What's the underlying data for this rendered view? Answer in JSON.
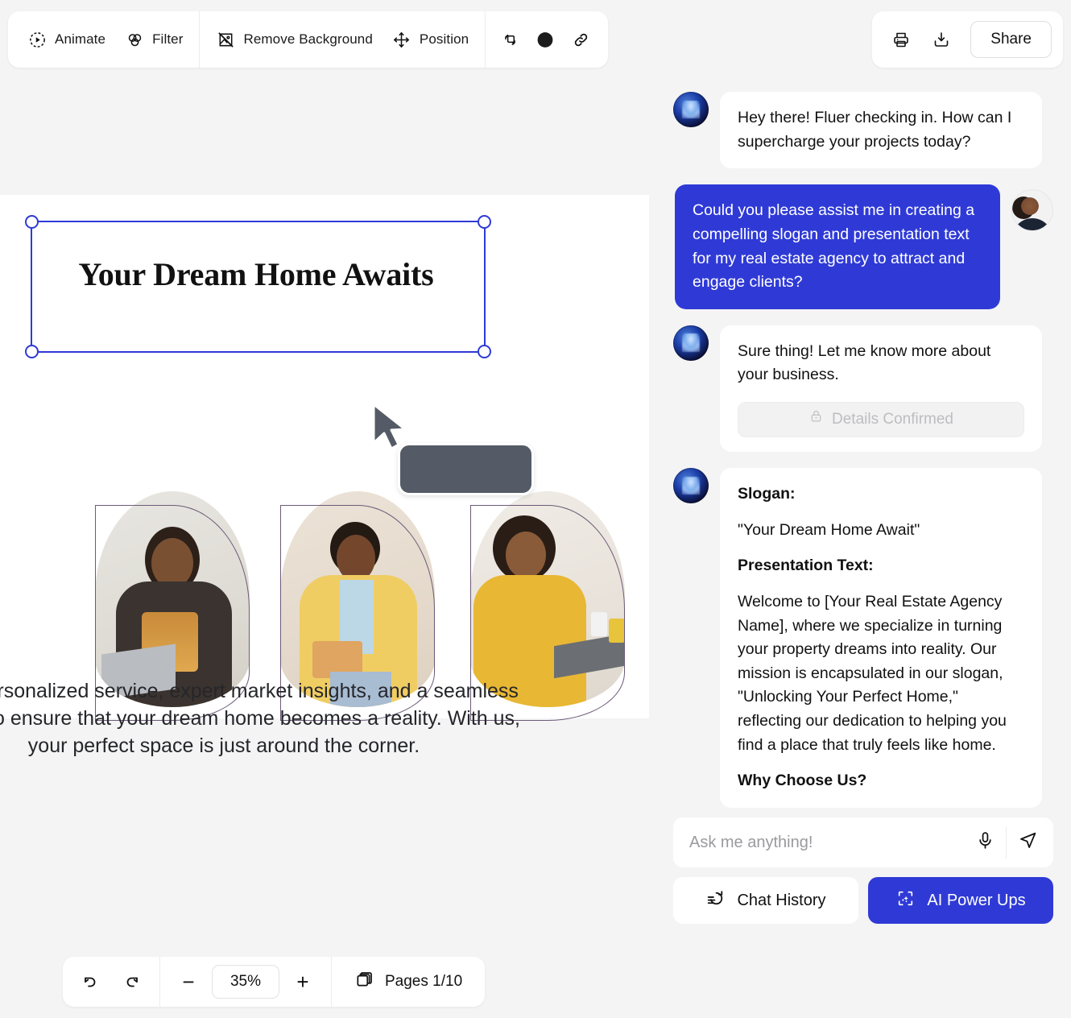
{
  "toolbar": {
    "items": [
      {
        "label": "Animate",
        "icon": "animate-icon"
      },
      {
        "label": "Filter",
        "icon": "filter-icon"
      },
      {
        "label": "Remove Background",
        "icon": "remove-background-icon"
      },
      {
        "label": "Position",
        "icon": "position-icon"
      }
    ],
    "icon_buttons": [
      {
        "name": "duplicate-icon"
      },
      {
        "name": "color-swatch-icon",
        "color": "#1c1c1c"
      },
      {
        "name": "link-icon"
      }
    ],
    "right": {
      "print_icon": "print-icon",
      "download_icon": "download-icon",
      "share_label": "Share"
    }
  },
  "canvas": {
    "slide_title": "Your Dream Home Awaits",
    "slide_body": "offer personalized service, expert market insights, and a seamless rience to ensure that your dream home becomes a reality. With us, your perfect space is just around the corner.",
    "slide_body_lines": [
      "offer personalized service, expert market insights, and a seamless",
      "rience to ensure that your dream home becomes a reality. With us,",
      "your perfect space is just around the corner."
    ],
    "cursor": "arrow-cursor",
    "tooltip_label": ""
  },
  "bottom_bar": {
    "undo_icon": "undo-icon",
    "redo_icon": "redo-icon",
    "zoom_out_label": "−",
    "zoom_value": "35%",
    "zoom_in_label": "+",
    "pages_icon": "pages-icon",
    "pages_label": "Pages 1/10"
  },
  "chat": {
    "messages": [
      {
        "role": "bot",
        "text": "Hey there! Fluer checking in. How can I supercharge your projects today?"
      },
      {
        "role": "user",
        "text": "Could you please assist me in creating a compelling slogan and presentation text for my real estate agency to attract and engage clients?"
      },
      {
        "role": "bot",
        "text": "Sure thing! Let me know more about your business.",
        "action_label": "Details Confirmed",
        "action_icon": "lock-icon"
      },
      {
        "role": "bot",
        "rich": [
          {
            "bold": true,
            "text": "Slogan:"
          },
          {
            "bold": false,
            "text": "\"Your Dream Home Await\""
          },
          {
            "bold": true,
            "text": "Presentation Text:"
          },
          {
            "bold": false,
            "text": "Welcome to [Your Real Estate Agency Name], where we specialize in turning your property dreams into reality. Our mission is encapsulated in our slogan, \"Unlocking Your Perfect Home,\" reflecting our dedication to helping you find a place that truly feels like home."
          },
          {
            "bold": true,
            "text": "Why Choose Us?"
          }
        ]
      }
    ],
    "composer": {
      "placeholder": "Ask me anything!",
      "value": "",
      "mic_icon": "microphone-icon",
      "send_icon": "send-icon"
    },
    "actions": {
      "chat_history_label": "Chat History",
      "chat_history_icon": "history-icon",
      "ai_power_ups_label": "AI Power Ups",
      "ai_power_ups_icon": "ai-sparkle-icon"
    }
  },
  "colors": {
    "accent": "#2F3AD6",
    "page_bg": "#F4F4F5",
    "surface": "#FFFFFF",
    "text": "#111111",
    "muted": "#BDBDC0",
    "tooltip": "#555B66"
  }
}
